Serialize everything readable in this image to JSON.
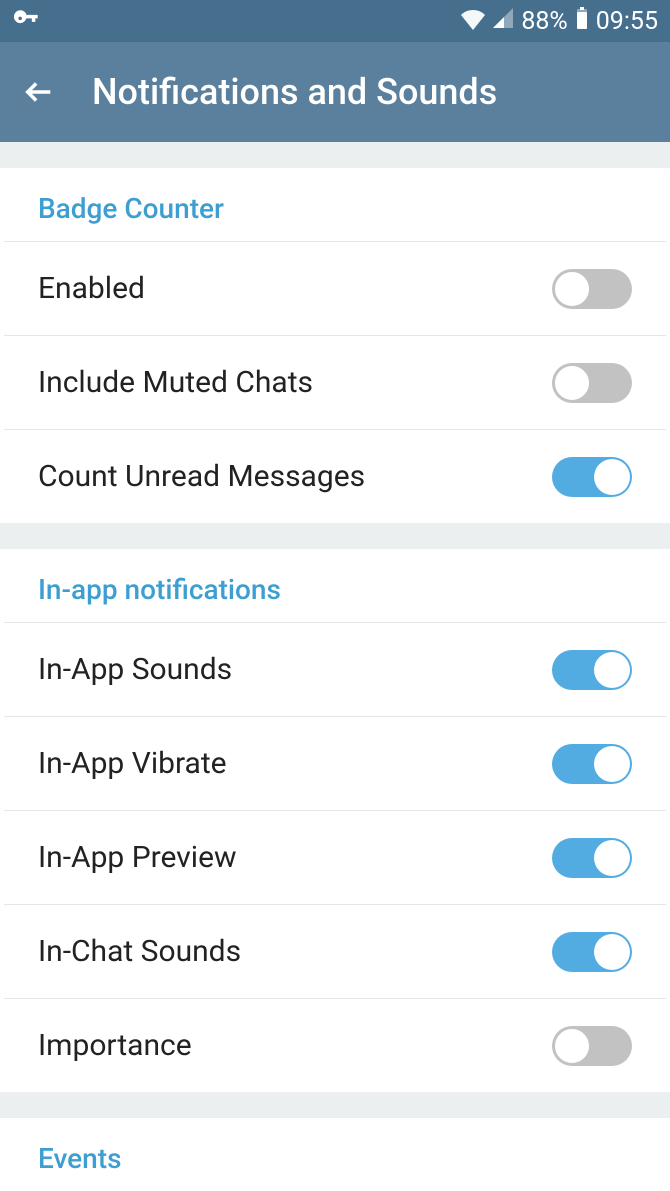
{
  "statusbar": {
    "battery_pct": "88%",
    "time": "09:55"
  },
  "header": {
    "title": "Notifications and Sounds"
  },
  "sections": {
    "badge": {
      "title": "Badge Counter"
    },
    "inapp": {
      "title": "In-app notifications"
    },
    "events": {
      "title": "Events"
    }
  },
  "rows": {
    "enabled": {
      "label": "Enabled",
      "on": false
    },
    "muted": {
      "label": "Include Muted Chats",
      "on": false
    },
    "unread": {
      "label": "Count Unread Messages",
      "on": true
    },
    "sounds": {
      "label": "In-App Sounds",
      "on": true
    },
    "vibrate": {
      "label": "In-App Vibrate",
      "on": true
    },
    "preview": {
      "label": "In-App Preview",
      "on": true
    },
    "chatsounds": {
      "label": "In-Chat Sounds",
      "on": true
    },
    "importance": {
      "label": "Importance",
      "on": false
    }
  }
}
